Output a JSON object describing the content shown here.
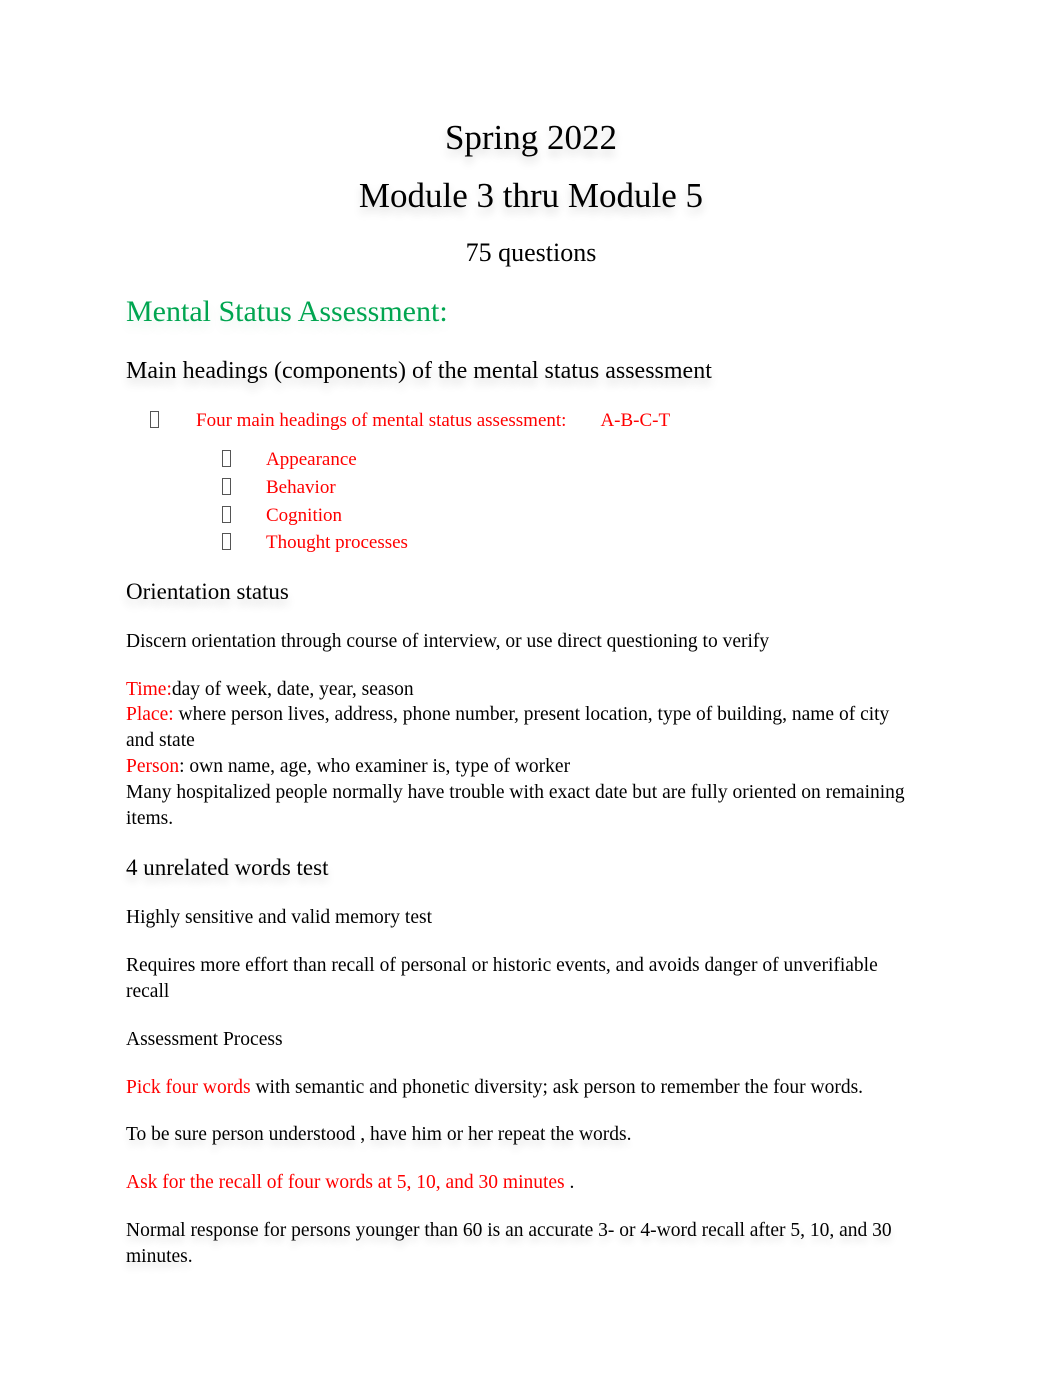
{
  "document": {
    "title_line_1": "Spring 2022",
    "title_line_2": "Module 3 thru Module 5",
    "subtitle": "75 questions"
  },
  "colors": {
    "heading_green": "#00A550",
    "accent_red": "#FF0000",
    "accent_blue": "#44619E",
    "body_black": "#000000",
    "page_background": "#FFFFFF"
  },
  "sections": {
    "mental_status": {
      "heading": "Mental Status Assessment:",
      "subheading": "Main headings (components) of the mental status assessment",
      "main_bullet": {
        "label": "Four main headings of mental status assessment:",
        "answer": "A-B-C-T",
        "bullet_glyph": "tofu-box"
      },
      "sub_bullets": [
        {
          "label": "Appearance"
        },
        {
          "label": "Behavior"
        },
        {
          "label": "Cognition"
        },
        {
          "label": "Thought processes"
        }
      ]
    },
    "orientation": {
      "heading": "Orientation status",
      "intro": "Discern orientation through course of interview, or use direct questioning to verify",
      "items": [
        {
          "label": "Time:",
          "text": "day of week, date, year, season",
          "label_color": "#FF0000",
          "colon_in_label": true
        },
        {
          "label": "Place:",
          "text": "where person lives, address, phone number, present location, type of building, name of city and state",
          "label_color": "#FF0000",
          "colon_in_label": true
        },
        {
          "label": "Person",
          "colon": ": ",
          "text": "own name, age, who examiner is, type of worker",
          "label_color": "#FF0000",
          "colon_in_label": false
        }
      ],
      "note": "Many hospitalized people normally have trouble with exact date but are fully oriented on remaining items."
    },
    "words_test": {
      "heading": "4 unrelated words test",
      "paragraphs": [
        "Highly sensitive and valid memory test",
        "Requires more effort than recall of personal or historic events, and avoids danger of unverifiable recall",
        "Assessment Process"
      ],
      "pick_words": {
        "red_part": "Pick four words",
        "black_part": " with semantic and phonetic diversity; ask person to remember the four words."
      },
      "understood_line": "To be sure person understood  , have him or her repeat the words.",
      "recall_line": {
        "red_part": "Ask for the recall of four words at 5, 10, and 30 minutes",
        "black_part": "  ."
      },
      "normal_response": "Normal response for persons younger than 60 is an accurate 3- or 4-word recall after 5, 10, and 30 minutes."
    }
  }
}
